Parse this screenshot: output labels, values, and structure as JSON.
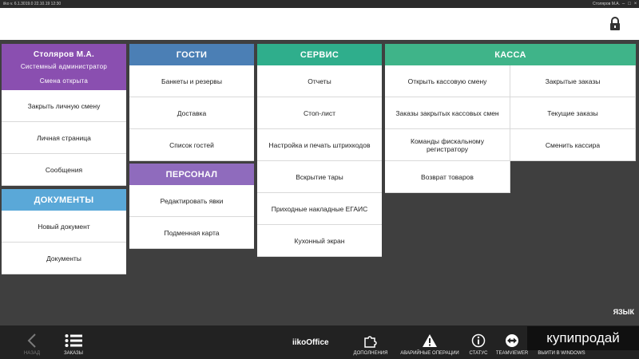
{
  "titlebar": {
    "left_text": "iiko v. 6.1.3019.0          22.10.19   12:30",
    "right_text": "Столяров М.А.",
    "min": "–",
    "max": "□",
    "close": "×"
  },
  "user_panel": {
    "name": "Столяров М.А.",
    "role": "Системный администратор",
    "shift": "Смена открыта",
    "items": [
      "Закрыть личную смену",
      "Личная страница",
      "Сообщения"
    ]
  },
  "documents": {
    "title": "ДОКУМЕНТЫ",
    "items": [
      "Новый документ",
      "Документы"
    ]
  },
  "guests": {
    "title": "ГОСТИ",
    "items": [
      "Банкеты и резервы",
      "Доставка",
      "Список гостей"
    ]
  },
  "staff": {
    "title": "ПЕРСОНАЛ",
    "items": [
      "Редактировать явки",
      "Подменная карта"
    ]
  },
  "service": {
    "title": "СЕРВИС",
    "items": [
      "Отчеты",
      "Стоп-лист",
      "Настройка и печать штрихкодов",
      "Вскрытие тары",
      "Приходные накладные ЕГАИС",
      "Кухонный экран"
    ]
  },
  "cashbox": {
    "title": "КАССА",
    "items": [
      "Открыть кассовую смену",
      "Закрытые заказы",
      "Заказы закрытых кассовых смен",
      "Текущие заказы",
      "Команды фискальному регистратору",
      "Сменить кассира",
      "Возврат товаров"
    ]
  },
  "language_label": "ЯЗЫК",
  "bottombar": {
    "back": "НАЗАД",
    "orders": "ЗАКАЗЫ",
    "brand": "iikoOffice",
    "addons": "ДОПОЛНЕНИЯ",
    "emergency": "АВАРИЙНЫЕ ОПЕРАЦИИ",
    "status": "СТАТУС",
    "teamviewer": "TEAMVIEWER",
    "exit": "ВЫЙТИ В WINDOWS"
  },
  "watermark": "купипродай",
  "colors": {
    "user_header": "#8a4fb0",
    "documents_header": "#5aa8d8",
    "guests_header": "#4b7fb5",
    "staff_header": "#8f6bbd",
    "service_header": "#2fae8c",
    "cashbox_header": "#3fb489",
    "background": "#3f3f3f",
    "bottombar": "#222222"
  },
  "icons": {
    "lock": "lock-icon",
    "back": "chevron-left-icon",
    "orders": "list-icon",
    "addons": "puzzle-icon",
    "emergency": "warning-icon",
    "status": "info-icon",
    "teamviewer": "teamviewer-icon"
  }
}
